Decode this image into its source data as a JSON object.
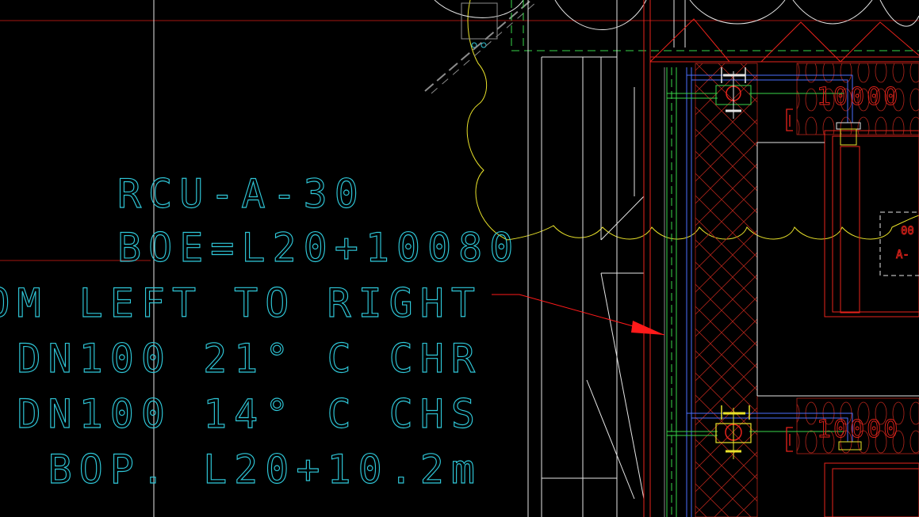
{
  "annotation": {
    "lines": [
      "RCU-A-30",
      "BOE=L20+10080",
      "FROM LEFT TO RIGHT",
      "DN100 21° C CHR",
      "DN100 14° C CHS",
      "BOP. L20+10.2m"
    ],
    "color": "#2fc7d8"
  },
  "leader": {
    "color": "#ff1a1a"
  },
  "tags": {
    "upper": "10000",
    "lower": "10000",
    "right_box_top": "00",
    "right_box_bottom": "A-"
  },
  "colors": {
    "background": "#000000",
    "red": "#e8231b",
    "dark_red": "#a4160f",
    "yellow": "#e9e22a",
    "green": "#38d64a",
    "blue": "#4b6fff",
    "white": "#e6e6e6",
    "grey": "#8c8c8c"
  }
}
